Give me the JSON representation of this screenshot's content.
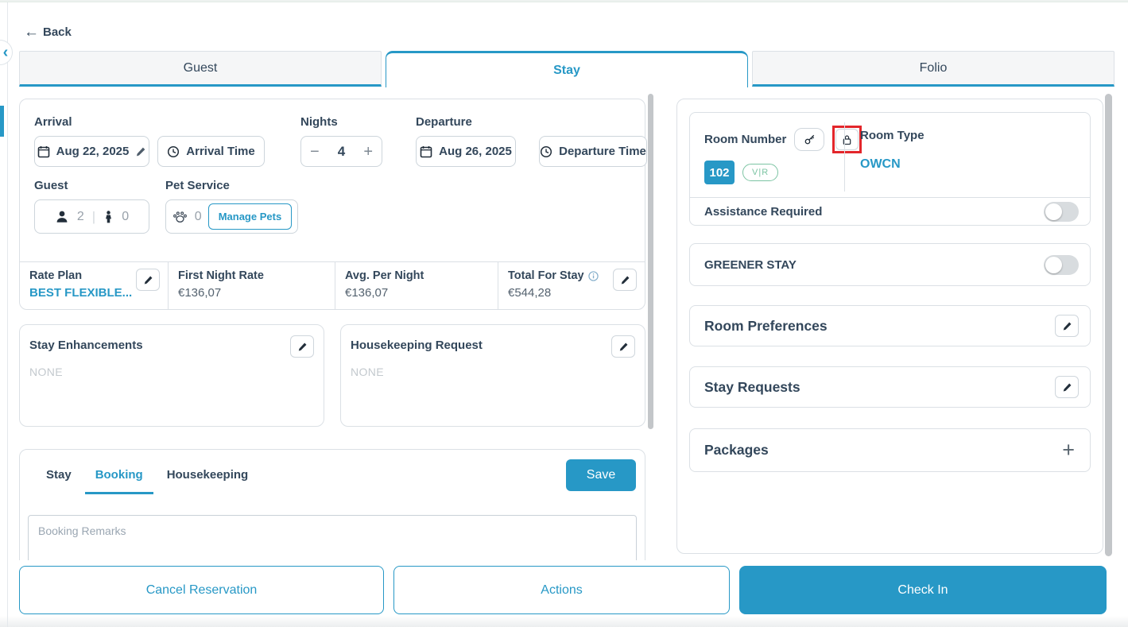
{
  "colors": {
    "accent": "#2798C6",
    "navy": "#33475B",
    "badge_green": "#7CC4A3",
    "highlight_red": "#E3262B"
  },
  "glyphs": {
    "back_arrow": "←",
    "chevron_left": "‹",
    "divider": "|",
    "minus": "−",
    "plus": "+",
    "add": "+"
  },
  "header": {
    "back_label": "Back"
  },
  "tabs": [
    {
      "label": "Guest"
    },
    {
      "label": "Stay"
    },
    {
      "label": "Folio"
    }
  ],
  "stay_form": {
    "arrival": {
      "label": "Arrival",
      "date": "Aug 22, 2025",
      "time_placeholder": "Arrival Time"
    },
    "nights": {
      "label": "Nights",
      "value": "4"
    },
    "departure": {
      "label": "Departure",
      "date": "Aug 26, 2025",
      "time_placeholder": "Departure Time"
    },
    "guest": {
      "label": "Guest",
      "adults": "2",
      "children": "0"
    },
    "pet_service": {
      "label": "Pet Service",
      "count": "0",
      "manage_button": "Manage Pets"
    },
    "rates": {
      "rate_plan_label": "Rate Plan",
      "rate_plan_value": "BEST FLEXIBLE...",
      "first_night_label": "First Night Rate",
      "first_night_value": "€136,07",
      "avg_label": "Avg. Per Night",
      "avg_value": "€136,07",
      "total_label": "Total For Stay",
      "total_value": "€544,28"
    },
    "stay_enhancements": {
      "title": "Stay Enhancements",
      "value": "NONE"
    },
    "housekeeping_request": {
      "title": "Housekeeping Request",
      "value": "NONE"
    }
  },
  "remarks": {
    "tabs": [
      {
        "label": "Stay"
      },
      {
        "label": "Booking"
      },
      {
        "label": "Housekeeping"
      }
    ],
    "save_button": "Save",
    "placeholder": "Booking Remarks"
  },
  "room_panel": {
    "room_number_label": "Room Number",
    "room_number": "102",
    "status_badge": "V|R",
    "room_type_label": "Room Type",
    "room_type": "OWCN",
    "assistance_label": "Assistance Required",
    "assistance_enabled": false,
    "greener_label": "GREENER STAY",
    "greener_enabled": false,
    "sections": [
      {
        "title": "Room Preferences"
      },
      {
        "title": "Stay Requests"
      },
      {
        "title": "Packages"
      }
    ]
  },
  "footer": {
    "cancel_button": "Cancel Reservation",
    "actions_button": "Actions",
    "checkin_button": "Check In"
  }
}
